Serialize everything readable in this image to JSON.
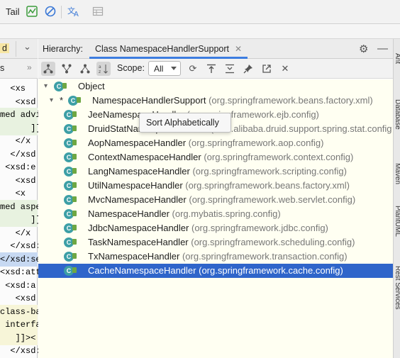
{
  "toolbar": {
    "tail_label": "Tail"
  },
  "icons": {
    "chart": "activity-monitor-icon",
    "block": "cancel-icon",
    "translate": "translate-icon",
    "grid": "table-icon"
  },
  "editor": {
    "tab_suffix": "d",
    "tab2": "s",
    "lines": [
      {
        "text": "  <xs",
        "hl": ""
      },
      {
        "text": "   <xsd",
        "hl": ""
      },
      {
        "text": "med advi",
        "hl": "green"
      },
      {
        "text": "      ]]",
        "hl": "green"
      },
      {
        "text": "   </x",
        "hl": ""
      },
      {
        "text": "  </xsd",
        "hl": ""
      },
      {
        "text": " <xsd:e",
        "hl": ""
      },
      {
        "text": "   <xsd",
        "hl": ""
      },
      {
        "text": "   <x",
        "hl": ""
      },
      {
        "text": "med aspe",
        "hl": "green"
      },
      {
        "text": "      ]]",
        "hl": "green"
      },
      {
        "text": "   </x",
        "hl": ""
      },
      {
        "text": "  </xsd:",
        "hl": ""
      },
      {
        "text": "</xsd:se",
        "hl": "blue"
      },
      {
        "text": "<xsd:att",
        "hl": ""
      },
      {
        "text": " <xsd:a",
        "hl": ""
      },
      {
        "text": "   <xsd",
        "hl": ""
      },
      {
        "text": "class-ba",
        "hl": "yellow"
      },
      {
        "text": " interfa",
        "hl": "yellow"
      },
      {
        "text": "   ]]><",
        "hl": "yellow"
      },
      {
        "text": "  </xsd:",
        "hl": ""
      }
    ]
  },
  "panel": {
    "title": "Hierarchy:",
    "tab_label": "Class NamespaceHandlerSupport",
    "scope_label": "Scope:",
    "scope_value": "All",
    "tooltip": "Sort Alphabetically"
  },
  "tree": {
    "root": {
      "name": "Object",
      "pkg": ""
    },
    "parent": {
      "prefix": "*",
      "name": "NamespaceHandlerSupport",
      "pkg": "(org.springframework.beans.factory.xml)"
    },
    "children": [
      {
        "name": "JeeNamespaceHandler",
        "pkg": "(org.springframework.ejb.config)",
        "selected": false
      },
      {
        "name": "DruidStatNamespaceHandler",
        "pkg": "(com.alibaba.druid.support.spring.stat.config",
        "selected": false
      },
      {
        "name": "AopNamespaceHandler",
        "pkg": "(org.springframework.aop.config)",
        "selected": false
      },
      {
        "name": "ContextNamespaceHandler",
        "pkg": "(org.springframework.context.config)",
        "selected": false
      },
      {
        "name": "LangNamespaceHandler",
        "pkg": "(org.springframework.scripting.config)",
        "selected": false
      },
      {
        "name": "UtilNamespaceHandler",
        "pkg": "(org.springframework.beans.factory.xml)",
        "selected": false
      },
      {
        "name": "MvcNamespaceHandler",
        "pkg": "(org.springframework.web.servlet.config)",
        "selected": false
      },
      {
        "name": "NamespaceHandler",
        "pkg": "(org.mybatis.spring.config)",
        "selected": false
      },
      {
        "name": "JdbcNamespaceHandler",
        "pkg": "(org.springframework.jdbc.config)",
        "selected": false
      },
      {
        "name": "TaskNamespaceHandler",
        "pkg": "(org.springframework.scheduling.config)",
        "selected": false
      },
      {
        "name": "TxNamespaceHandler",
        "pkg": "(org.springframework.transaction.config)",
        "selected": false
      },
      {
        "name": "CacheNamespaceHandler",
        "pkg": "(org.springframework.cache.config)",
        "selected": true
      }
    ]
  },
  "right_strip": {
    "labels": [
      "Ant",
      "Database",
      "Maven",
      "PlantUML",
      "Rest Services"
    ]
  }
}
